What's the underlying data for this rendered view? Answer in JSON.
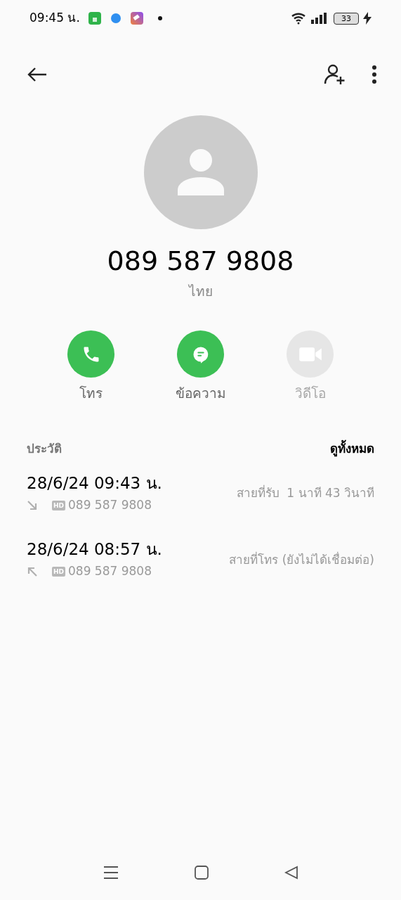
{
  "status_bar": {
    "time": "09:45 น.",
    "battery": "33"
  },
  "contact": {
    "number": "089 587 9808",
    "region": "ไทย"
  },
  "actions": [
    {
      "kind": "call",
      "label": "โทร",
      "disabled": false
    },
    {
      "kind": "message",
      "label": "ข้อความ",
      "disabled": false
    },
    {
      "kind": "video",
      "label": "วิดีโอ",
      "disabled": true
    }
  ],
  "history": {
    "title": "ประวัติ",
    "see_all": "ดูทั้งหมด",
    "entries": [
      {
        "datetime": "28/6/24 09:43 น.",
        "incoming": true,
        "hd": "HD",
        "number": "089 587 9808",
        "detail": "สายที่รับ  1 นาที 43 วินาที"
      },
      {
        "datetime": "28/6/24 08:57 น.",
        "incoming": false,
        "hd": "HD",
        "number": "089 587 9808",
        "detail": "สายที่โทร (ยังไม่ได้เชื่อมต่อ)"
      }
    ]
  }
}
